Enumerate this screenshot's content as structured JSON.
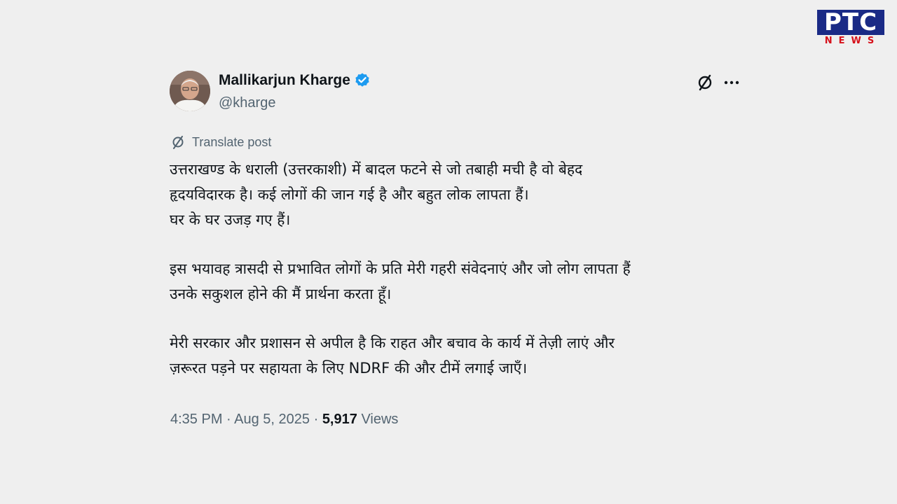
{
  "logo": {
    "top_text": "PTC",
    "bottom_text": "NEWS",
    "colors": {
      "navy": "#1a2a86",
      "red": "#d6111b"
    }
  },
  "tweet": {
    "author": {
      "display_name": "Mallikarjun Kharge",
      "handle": "@kharge",
      "verified": true,
      "verified_color": "#1d9bf0"
    },
    "icons": [
      "grok-icon",
      "more-icon",
      "translate-icon"
    ],
    "translate_label": "Translate post",
    "paragraphs": [
      {
        "lines": [
          "उत्तराखण्ड के धराली (उत्तरकाशी) में बादल फटने से जो तबाही मची है वो बेहद",
          "हृदयविदारक है। कई लोगों की जान गई है और बहुत लोक लापता हैं।",
          "घर के घर उजड़ गए हैं।"
        ]
      },
      {
        "lines": [
          "इस भयावह त्रासदी से प्रभावित लोगों के प्रति मेरी गहरी संवेदनाएं और जो लोग लापता हैं",
          "उनके सकुशल होने की मैं प्रार्थना करता हूँ।"
        ]
      },
      {
        "lines": [
          "मेरी सरकार और प्रशासन से अपील है कि राहत और बचाव के कार्य में तेज़ी लाएं और",
          "ज़रूरत पड़ने पर सहायता के लिए NDRF की और टीमें लगाई जाएँ।"
        ]
      }
    ],
    "meta": {
      "time": "4:35 PM",
      "separator": " · ",
      "date": "Aug 5, 2025",
      "views_count": "5,917",
      "views_label": "Views"
    }
  },
  "colors": {
    "background": "#efefef",
    "text_primary": "#0f1419",
    "text_secondary": "#536471"
  }
}
